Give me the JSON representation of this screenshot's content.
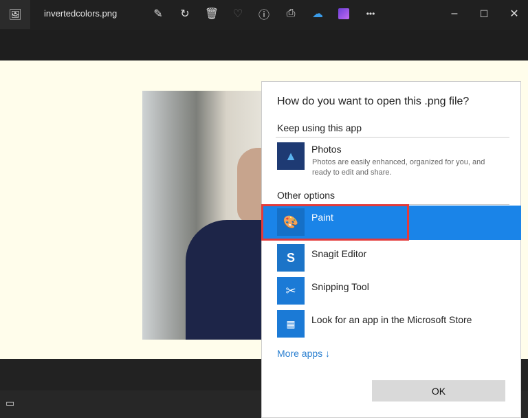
{
  "titlebar": {
    "filename": "invertedcolors.png",
    "toolbar": [
      "edit",
      "rotate",
      "delete",
      "favorite",
      "info",
      "print",
      "onedrive",
      "clipchamp",
      "more"
    ],
    "more_label": "•••"
  },
  "dialog": {
    "title": "How do you want to open this .png file?",
    "keep_heading": "Keep using this app",
    "photos": {
      "name": "Photos",
      "desc1": "Photos are easily enhanced, organized for you, and",
      "desc2": "ready to edit and share."
    },
    "other_heading": "Other options",
    "options": [
      {
        "name": "Paint"
      },
      {
        "name": "Snagit Editor"
      },
      {
        "name": "Snipping Tool"
      },
      {
        "name": "Look for an app in the Microsoft Store"
      }
    ],
    "more_apps": "More apps ↓",
    "ok": "OK"
  },
  "colors": {
    "accent": "#1a84e8",
    "highlight": "#e33b3b"
  }
}
